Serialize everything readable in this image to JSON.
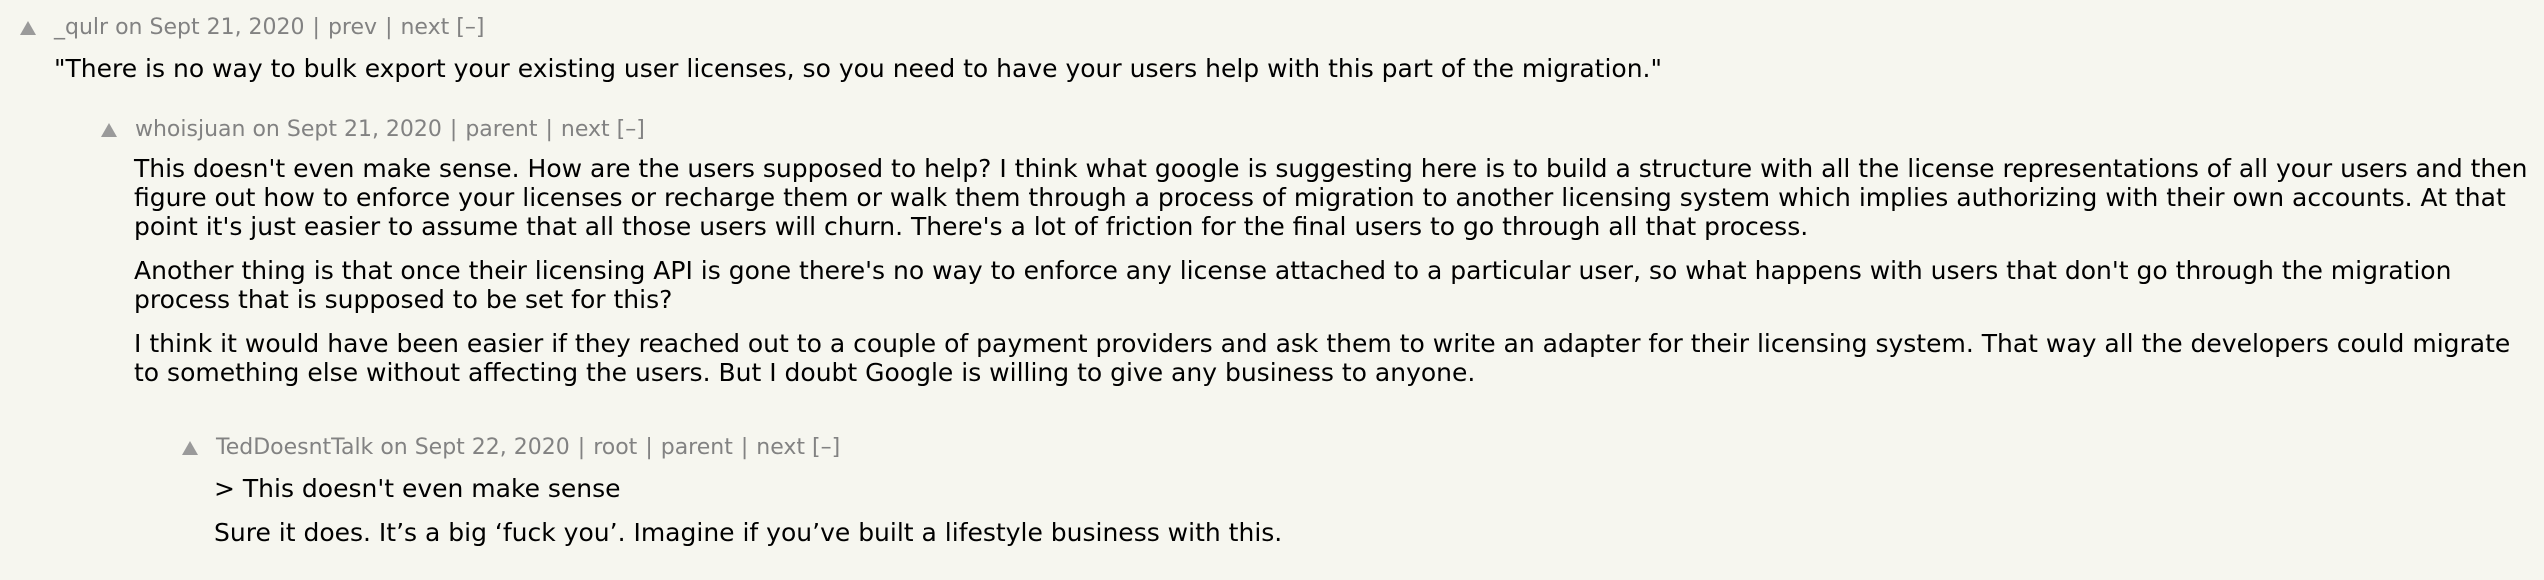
{
  "comments": [
    {
      "user": "_qulr",
      "date": "Sept 21, 2020",
      "links": [
        "prev",
        "next"
      ],
      "toggle": "[–]",
      "paragraphs": [
        "\"There is no way to bulk export your existing user licenses, so you need to have your users help with this part of the migration.\""
      ]
    },
    {
      "user": "whoisjuan",
      "date": "Sept 21, 2020",
      "links": [
        "parent",
        "next"
      ],
      "toggle": "[–]",
      "paragraphs": [
        "This doesn't even make sense. How are the users supposed to help? I think what google is suggesting here is to build a structure with all the license representations of all your users and then figure out how to enforce your licenses or recharge them or walk them through a process of migration to another licensing system which implies authorizing with their own accounts. At that point it's just easier to assume that all those users will churn. There's a lot of friction for the final users to go through all that process.",
        "Another thing is that once their licensing API is gone there's no way to enforce any license attached to a particular user, so what happens with users that don't go through the migration process that is supposed to be set for this?",
        "I think it would have been easier if they reached out to a couple of payment providers and ask them to write an adapter for their licensing system. That way all the developers could migrate to something else without affecting the users. But I doubt Google is willing to give any business to anyone."
      ]
    },
    {
      "user": "TedDoesntTalk",
      "date": "Sept 22, 2020",
      "links": [
        "root",
        "parent",
        "next"
      ],
      "toggle": "[–]",
      "paragraphs": [
        "> This doesn't even make sense",
        "Sure it does. It’s a big ‘fuck you’. Imagine if you’ve built a lifestyle business with this."
      ]
    }
  ],
  "labels": {
    "on": "on",
    "sep": "|"
  },
  "colors": {
    "background": "#f6f6ef",
    "meta": "#828282",
    "text": "#000000"
  },
  "icons": {
    "vote": "upvote-arrow-icon"
  }
}
